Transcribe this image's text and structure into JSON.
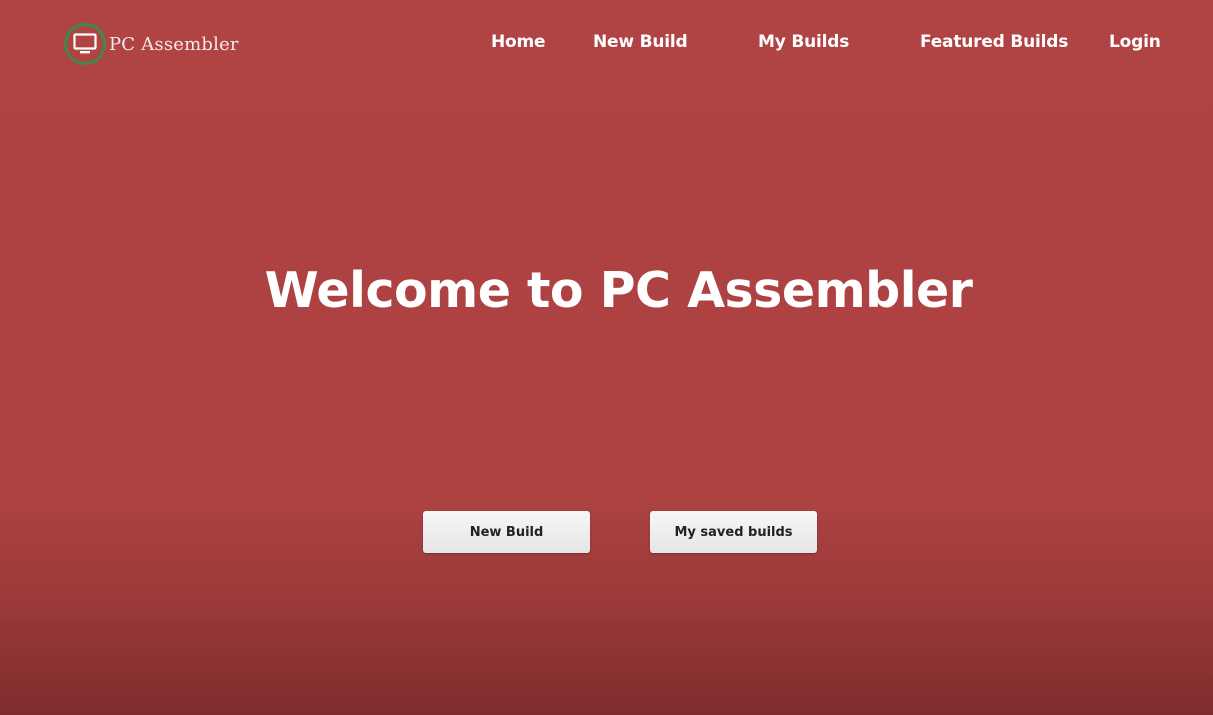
{
  "header": {
    "brand_name": "PC Assembler",
    "logo_icon": "monitor-icon",
    "nav": {
      "home": "Home",
      "new_build": "New Build",
      "my_builds": "My Builds",
      "featured_builds": "Featured Builds",
      "login": "Login"
    }
  },
  "hero": {
    "title": "Welcome to PC Assembler",
    "buttons": {
      "new_build": "New Build",
      "saved_builds": "My saved builds"
    }
  },
  "colors": {
    "background": "#b04343",
    "background_bottom": "#7f2c2c",
    "logo_ring": "#3f8a4a",
    "text": "#ffffff",
    "button_bg": "#f2f2f2"
  }
}
